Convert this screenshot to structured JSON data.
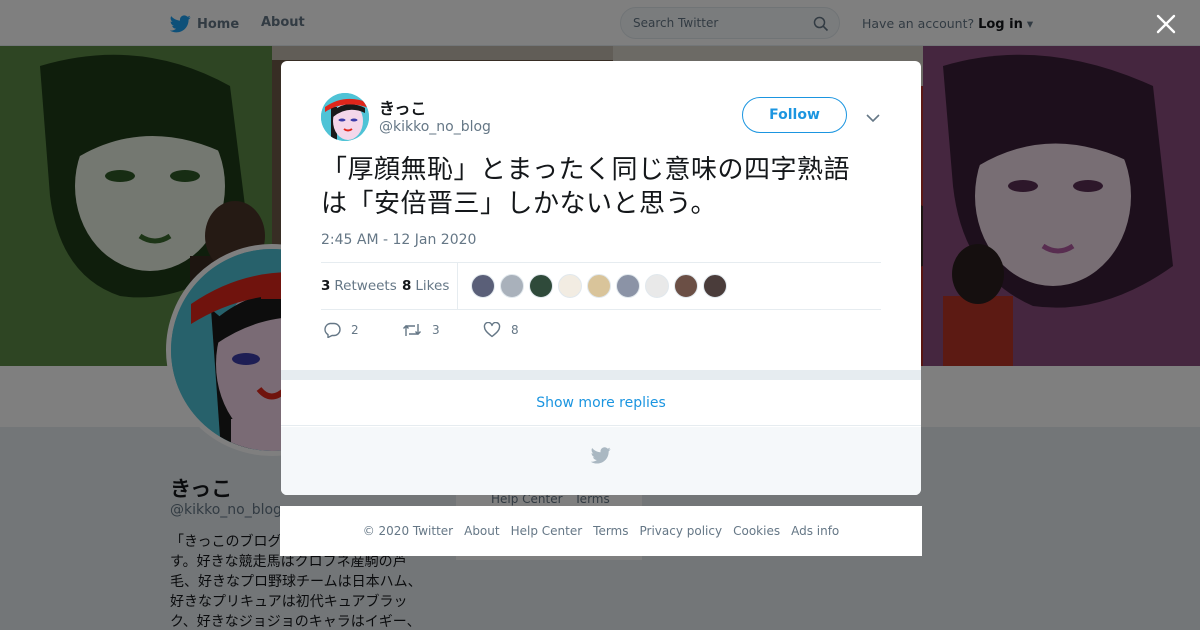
{
  "colors": {
    "brand": "#1da1f2",
    "link": "#1b95e0",
    "text": "#14171a",
    "muted": "#657786"
  },
  "header": {
    "home_label": "Home",
    "about_label": "About",
    "search_placeholder": "Search Twitter",
    "have_account": "Have an account?",
    "login_label": "Log in"
  },
  "profile": {
    "name": "きっこ",
    "handle": "@kikko_no_blog",
    "bio_lines": [
      "「きっこのブログ",
      "す。好きな競走馬はクロフネ産駒の芦",
      "毛、好きなプロ野球チームは日本ハム、",
      "好きなプリキュアは初代キュアブラッ",
      "ク、好きなジョジョのキャラはイギー、"
    ],
    "side_links": [
      "Help Center",
      "Terms"
    ]
  },
  "tweet": {
    "name": "きっこ",
    "handle": "@kikko_no_blog",
    "follow_label": "Follow",
    "text_line1": "「厚顔無恥」とまったく同じ意味の四字熟語",
    "text_line2": "は「安倍晋三」しかないと思う。",
    "timestamp": "2:45 AM - 12 Jan 2020",
    "retweets_count": "3",
    "retweets_label": "Retweets",
    "likes_count": "8",
    "likes_label": "Likes",
    "reply_count": "2",
    "retweet_count": "3",
    "like_count": "8"
  },
  "likers": [
    {
      "color": "#5a5f78"
    },
    {
      "color": "#a9b1bb"
    },
    {
      "color": "#2f4a3a"
    },
    {
      "color": "#f2ece2"
    },
    {
      "color": "#d9c49a"
    },
    {
      "color": "#8b93a6"
    },
    {
      "color": "#e9e9e9"
    },
    {
      "color": "#6b4f45"
    },
    {
      "color": "#4a3c3a"
    }
  ],
  "show_more_label": "Show more replies",
  "footer": {
    "copyright": "© 2020 Twitter",
    "about": "About",
    "help": "Help Center",
    "terms": "Terms",
    "privacy": "Privacy policy",
    "cookies": "Cookies",
    "ads": "Ads info"
  }
}
